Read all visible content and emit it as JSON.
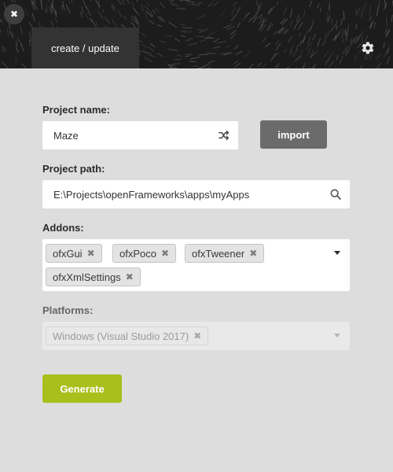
{
  "window": {
    "close_icon": "close-icon"
  },
  "header": {
    "tab_label": "create / update",
    "settings_icon": "gear-icon"
  },
  "project_name": {
    "label": "Project name:",
    "value": "Maze",
    "icon": "shuffle-icon"
  },
  "import_button": {
    "label": "import"
  },
  "project_path": {
    "label": "Project path:",
    "value": "E:\\Projects\\openFrameworks\\apps\\myApps",
    "icon": "search-icon"
  },
  "addons": {
    "label": "Addons:",
    "tags": [
      "ofxGui",
      "ofxPoco",
      "ofxTweener",
      "ofxXmlSettings"
    ],
    "remove_glyph": "✖",
    "icon": "chevron-down-icon"
  },
  "platforms": {
    "label": "Platforms:",
    "tags": [
      "Windows (Visual Studio 2017)"
    ],
    "remove_glyph": "✖",
    "disabled": true,
    "icon": "chevron-down-icon"
  },
  "generate_button": {
    "label": "Generate"
  },
  "colors": {
    "background": "#dddddd",
    "header": "#1c1c1c",
    "tab": "#333333",
    "import_button": "#6b6b6b",
    "generate_button": "#a9bf1c"
  }
}
